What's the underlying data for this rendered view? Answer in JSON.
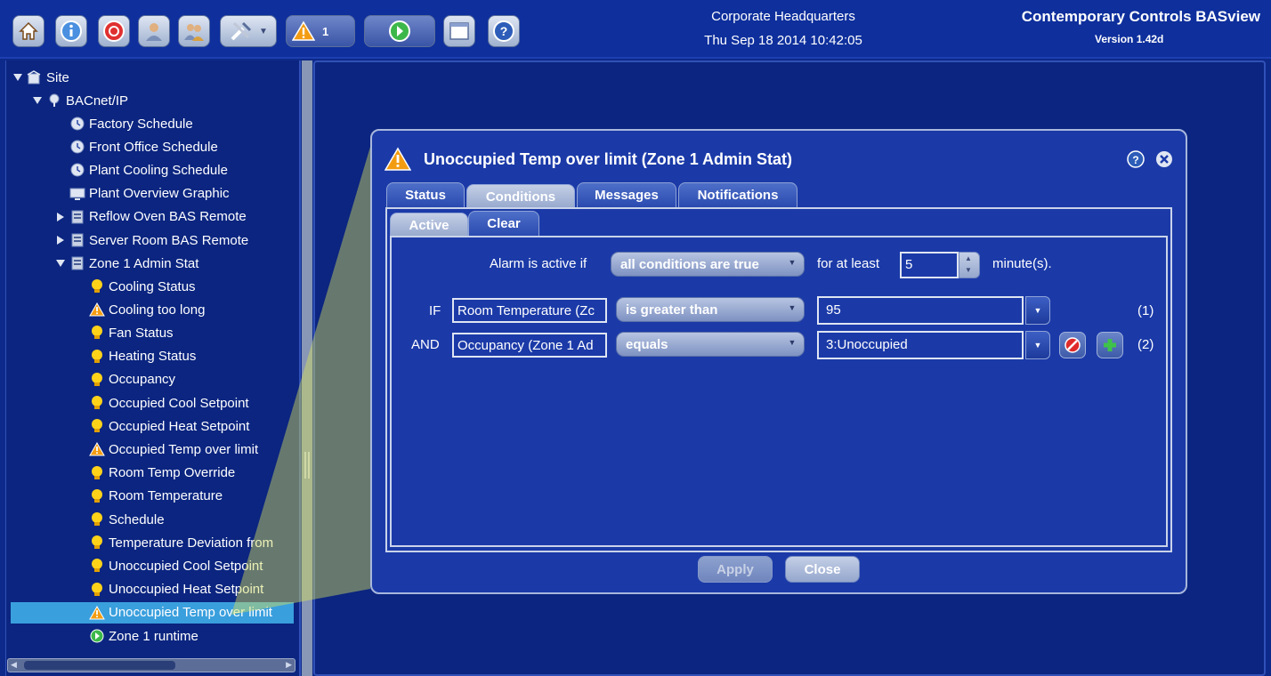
{
  "toolbar": {
    "alarm_count": "1",
    "site_title": "Corporate Headquarters",
    "datetime": "Thu Sep 18 2014 10:42:05",
    "brand": "Contemporary Controls BASview",
    "version": "Version 1.42d",
    "icons": [
      "home-icon",
      "info-icon",
      "alarm-bell-icon",
      "user-icon",
      "users-icon",
      "tools-icon",
      "warning-icon",
      "run-icon",
      "window-icon",
      "help-icon"
    ]
  },
  "tree": {
    "root": "Site",
    "network": "BACnet/IP",
    "items": [
      {
        "label": "Factory Schedule",
        "icon": "schedule-icon"
      },
      {
        "label": "Front Office Schedule",
        "icon": "schedule-icon"
      },
      {
        "label": "Plant Cooling Schedule",
        "icon": "schedule-icon"
      },
      {
        "label": "Plant Overview Graphic",
        "icon": "graphic-icon"
      },
      {
        "label": "Reflow Oven BAS Remote",
        "icon": "device-icon"
      },
      {
        "label": "Server Room BAS Remote",
        "icon": "device-icon"
      },
      {
        "label": "Zone 1 Admin Stat",
        "icon": "device-icon"
      }
    ],
    "children": [
      {
        "label": "Cooling Status",
        "icon": "bulb-icon"
      },
      {
        "label": "Cooling too long",
        "icon": "warning-icon"
      },
      {
        "label": "Fan Status",
        "icon": "bulb-icon"
      },
      {
        "label": "Heating Status",
        "icon": "bulb-icon"
      },
      {
        "label": "Occupancy",
        "icon": "bulb-icon"
      },
      {
        "label": "Occupied Cool Setpoint",
        "icon": "bulb-icon"
      },
      {
        "label": "Occupied Heat Setpoint",
        "icon": "bulb-icon"
      },
      {
        "label": "Occupied Temp over limit",
        "icon": "warning-icon"
      },
      {
        "label": "Room Temp Override",
        "icon": "bulb-icon"
      },
      {
        "label": "Room Temperature",
        "icon": "bulb-icon"
      },
      {
        "label": "Schedule",
        "icon": "bulb-icon"
      },
      {
        "label": "Temperature Deviation from",
        "icon": "bulb-icon"
      },
      {
        "label": "Unoccupied Cool Setpoint",
        "icon": "bulb-icon"
      },
      {
        "label": "Unoccupied Heat Setpoint",
        "icon": "bulb-icon"
      },
      {
        "label": "Unoccupied Temp over limit",
        "icon": "warning-icon",
        "selected": true
      },
      {
        "label": "Zone 1 runtime",
        "icon": "runtime-icon"
      }
    ]
  },
  "dialog": {
    "title": "Unoccupied Temp over limit (Zone 1 Admin Stat)",
    "tabs": [
      "Status",
      "Conditions",
      "Messages",
      "Notifications"
    ],
    "active_tab": "Conditions",
    "subtabs": [
      "Active",
      "Clear"
    ],
    "active_subtab": "Active",
    "alarm_active_if": "Alarm is active if",
    "condition_mode": "all conditions are true",
    "for_at_least": "for at least",
    "minutes_value": "5",
    "minutes_unit": "minute(s).",
    "conditions": [
      {
        "joiner": "IF",
        "object": "Room Temperature (Zc",
        "operator": "is greater than",
        "value": "95",
        "index": "(1)"
      },
      {
        "joiner": "AND",
        "object": "Occupancy (Zone 1 Ad",
        "operator": "equals",
        "value": "3:Unoccupied",
        "index": "(2)"
      }
    ],
    "apply_label": "Apply",
    "close_label": "Close"
  }
}
